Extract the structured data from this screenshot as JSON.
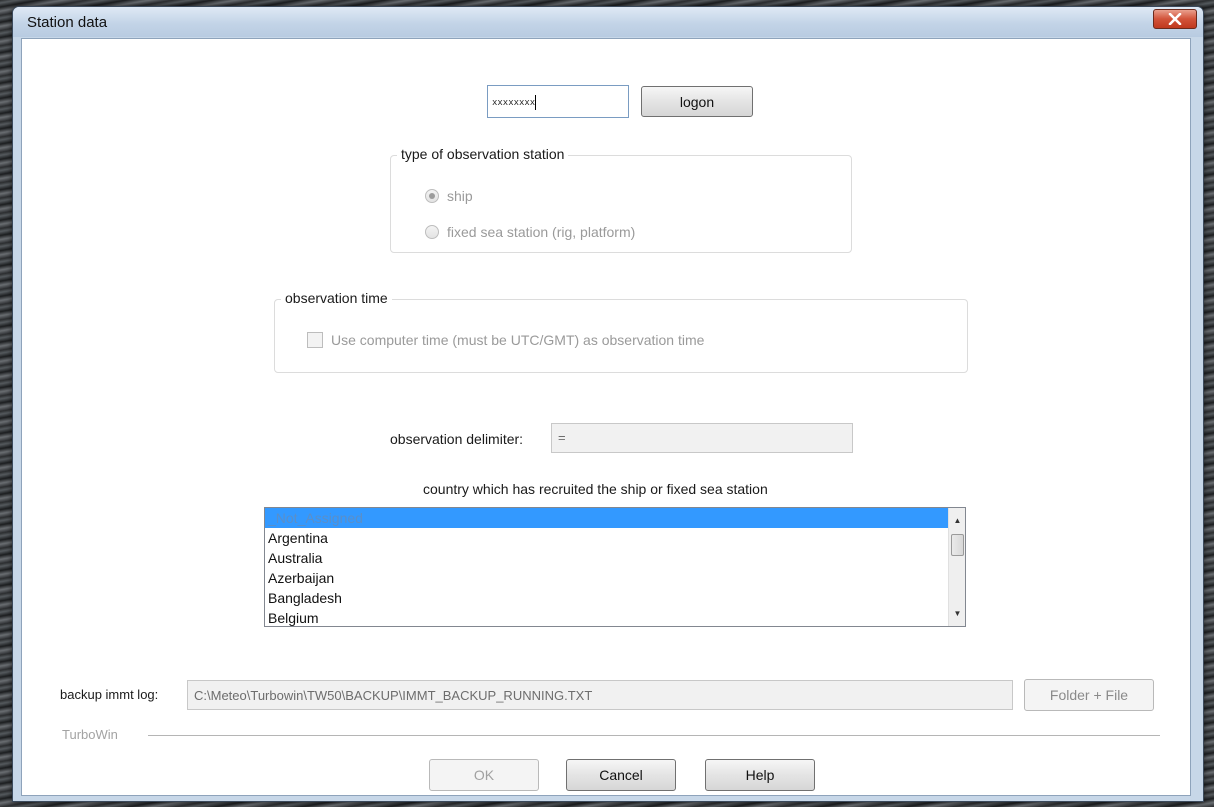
{
  "window": {
    "title": "Station data",
    "close_icon": "close-icon"
  },
  "logon": {
    "password_value": "xxxxxxxx",
    "button_label": "logon"
  },
  "station_type": {
    "legend": "type of observation station",
    "options": [
      {
        "label": "ship",
        "selected": true
      },
      {
        "label": "fixed sea station (rig, platform)",
        "selected": false
      }
    ]
  },
  "observation_time": {
    "legend": "observation time",
    "checkbox_label": "Use computer time (must be UTC/GMT) as observation time",
    "checked": false
  },
  "delimiter": {
    "label": "observation delimiter:",
    "value": "="
  },
  "country": {
    "label": "country which has recruited the ship or fixed sea station",
    "items": [
      "_Not_Assigned",
      "Argentina",
      "Australia",
      "Azerbaijan",
      "Bangladesh",
      "Belgium"
    ],
    "selected_index": 0
  },
  "backup": {
    "label": "backup immt log:",
    "path": "C:\\Meteo\\Turbowin\\TW50\\BACKUP\\IMMT_BACKUP_RUNNING.TXT",
    "button_label": "Folder + File"
  },
  "footer": {
    "group_label": "TurboWin",
    "ok_label": "OK",
    "cancel_label": "Cancel",
    "help_label": "Help"
  },
  "colors": {
    "selection": "#3399ff",
    "titlebar": "#c7d7e8",
    "close": "#d2533a"
  }
}
